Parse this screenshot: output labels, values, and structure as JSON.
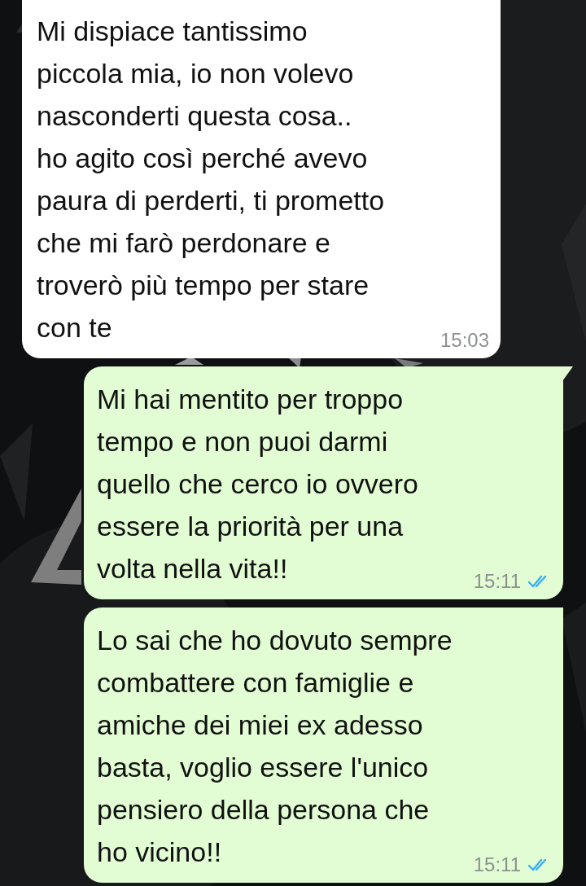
{
  "messages": [
    {
      "kind": "incoming",
      "text": "Mi dispiace tantissimo\npiccola mia, io non volevo\nnasconderti questa cosa..\nho agito così perché avevo\npaura di perderti, ti prometto\nche mi farò perdonare e\ntroverò più tempo per stare\ncon te",
      "time": "15:03",
      "tail": false
    },
    {
      "kind": "outgoing",
      "text": "Mi hai mentito per troppo\ntempo e non puoi darmi\nquello che cerco io ovvero\nessere la priorità per una\nvolta nella vita!!",
      "time": "15:11",
      "tail": true,
      "read": true
    },
    {
      "kind": "outgoing",
      "text": "Lo sai che ho dovuto sempre\ncombattere con famiglie e\namiche dei miei ex adesso\nbasta, voglio essere l'unico\npensiero della persona che\nho vicino!!",
      "time": "15:11",
      "tail": false,
      "read": true
    }
  ]
}
